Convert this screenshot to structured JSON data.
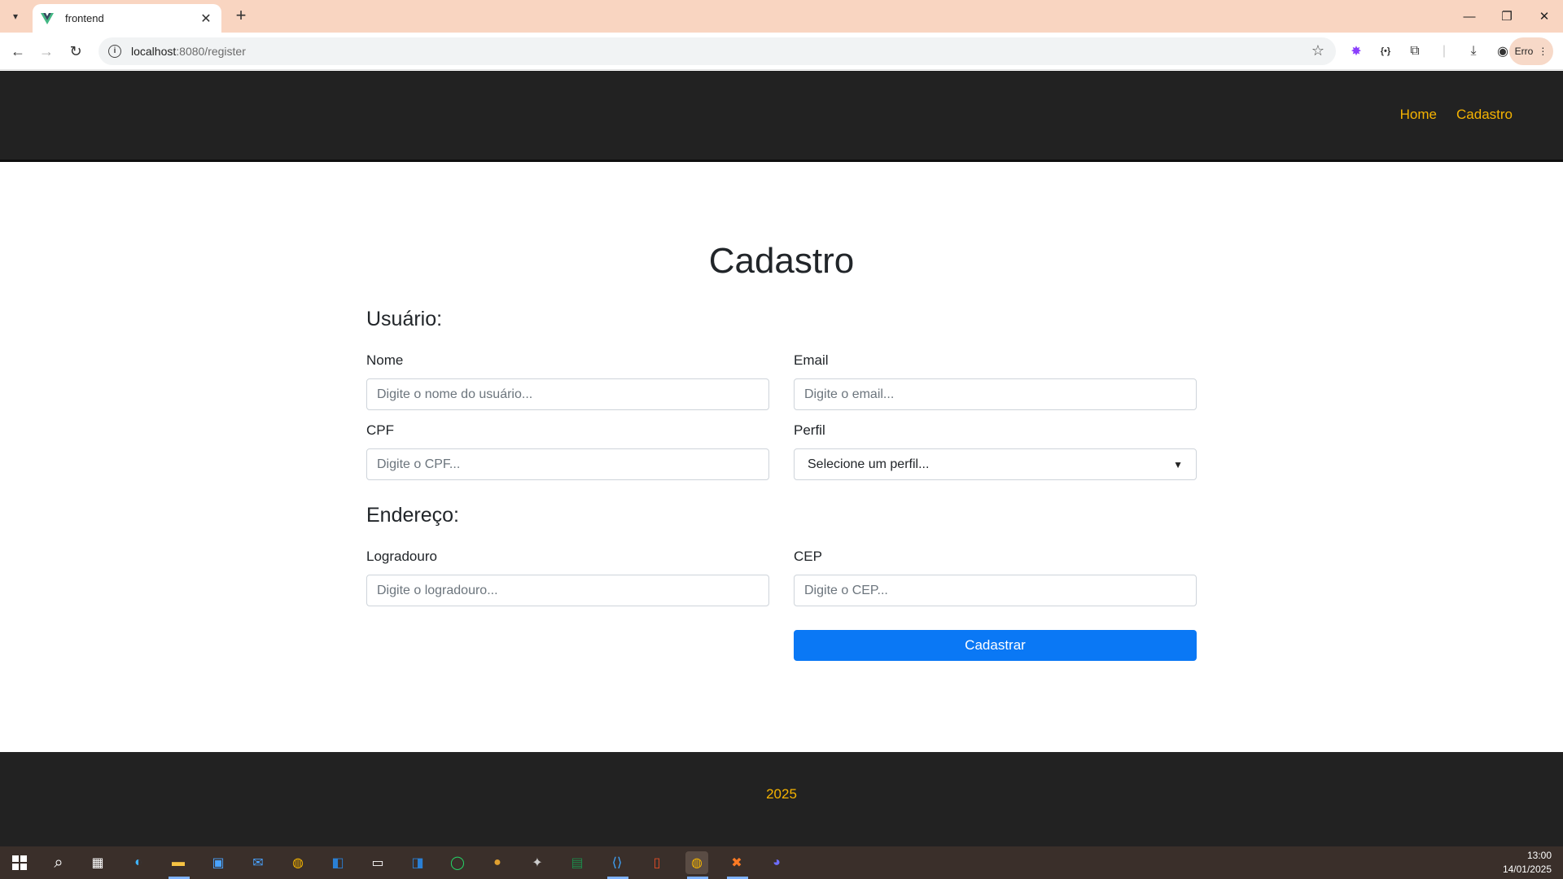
{
  "browser": {
    "tab_title": "frontend",
    "url_host": "localhost",
    "url_path": ":8080/register",
    "profile_label": "Erro"
  },
  "nav": {
    "home": "Home",
    "cadastro": "Cadastro"
  },
  "page": {
    "title": "Cadastro",
    "usuario_section": "Usuário:",
    "endereco_section": "Endereço:"
  },
  "fields": {
    "nome": {
      "label": "Nome",
      "placeholder": "Digite o nome do usuário..."
    },
    "email": {
      "label": "Email",
      "placeholder": "Digite o email..."
    },
    "cpf": {
      "label": "CPF",
      "placeholder": "Digite o CPF..."
    },
    "perfil": {
      "label": "Perfil",
      "selected": "Selecione um perfil..."
    },
    "logradouro": {
      "label": "Logradouro",
      "placeholder": "Digite o logradouro..."
    },
    "cep": {
      "label": "CEP",
      "placeholder": "Digite o CEP..."
    }
  },
  "submit_label": "Cadastrar",
  "footer": {
    "text": "2025"
  },
  "taskbar": {
    "time": "13:00",
    "date": "14/01/2025"
  },
  "colors": {
    "accent": "#f5b301",
    "primary_button": "#0a78f5",
    "header_bg": "#222222",
    "tabbar_bg": "#f9d5c1"
  }
}
